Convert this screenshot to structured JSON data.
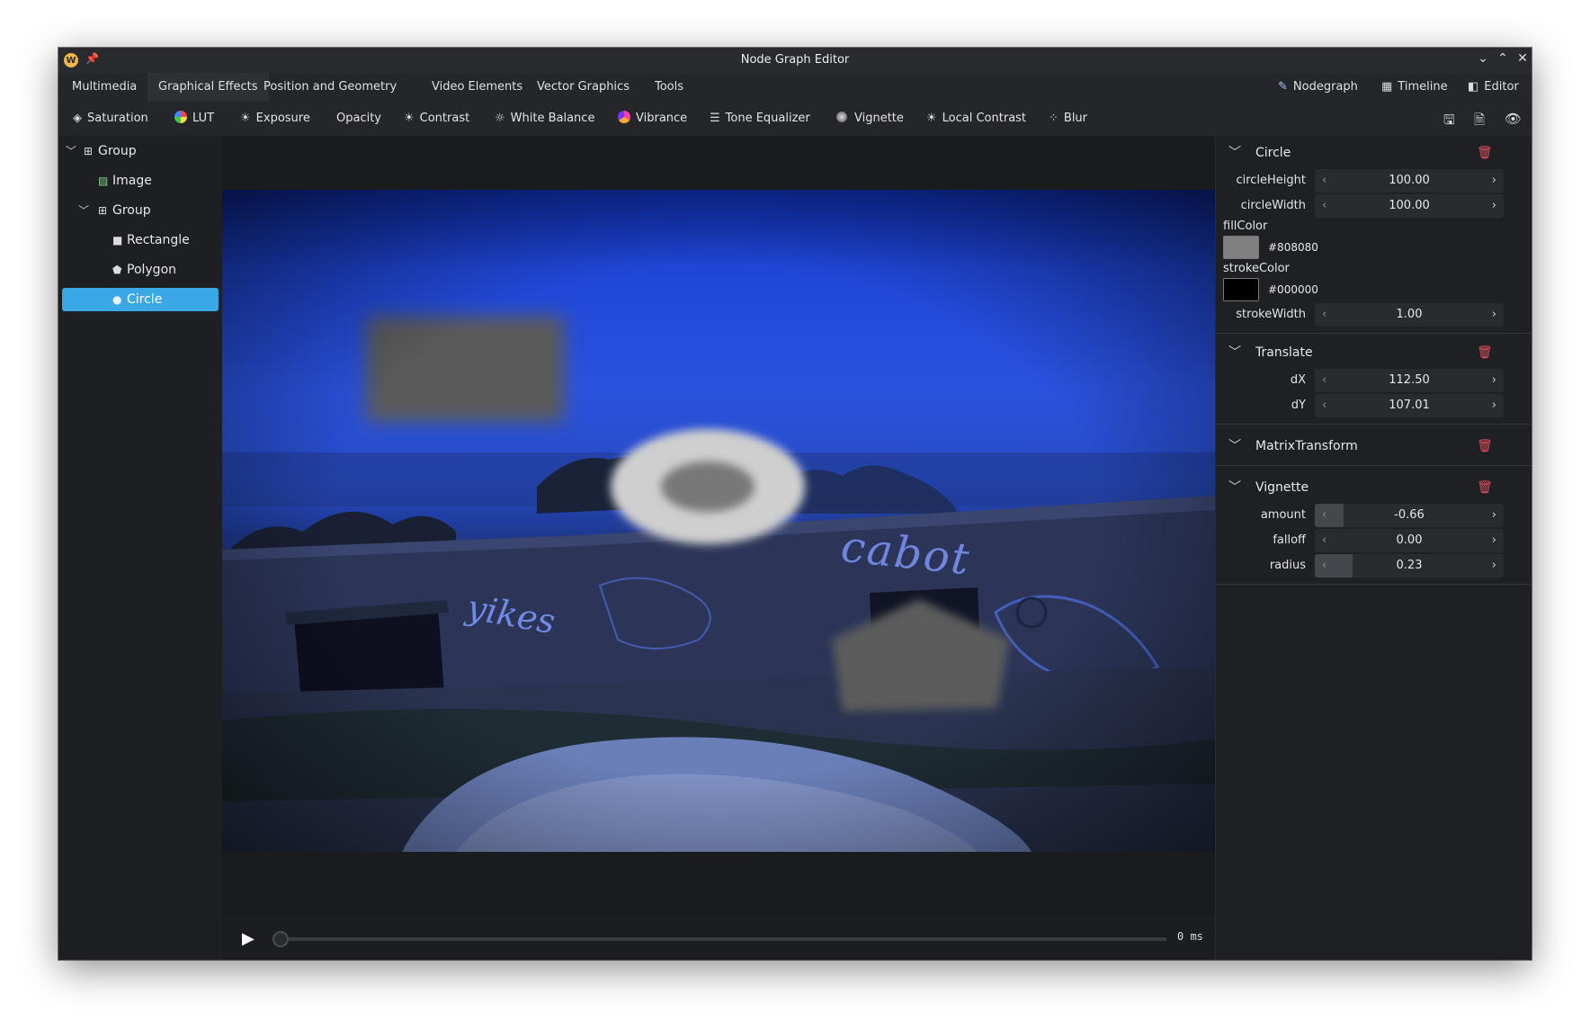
{
  "window": {
    "title": "Node Graph Editor",
    "app_icon_letter": "W"
  },
  "menu": {
    "tabs": [
      "Multimedia",
      "Graphical Effects",
      "Position and Geometry",
      "Video Elements",
      "Vector Graphics",
      "Tools"
    ],
    "active_tab": "Graphical Effects",
    "right": {
      "nodegraph": "Nodegraph",
      "timeline": "Timeline",
      "editor": "Editor"
    }
  },
  "toolbar": {
    "saturation": "Saturation",
    "lut": "LUT",
    "exposure": "Exposure",
    "opacity": "Opacity",
    "contrast": "Contrast",
    "white_balance": "White Balance",
    "vibrance": "Vibrance",
    "tone_equalizer": "Tone Equalizer",
    "vignette": "Vignette",
    "local_contrast": "Local Contrast",
    "blur": "Blur"
  },
  "tree": {
    "items": [
      {
        "label": "Group",
        "depth": 0,
        "expanded": true
      },
      {
        "label": "Image",
        "depth": 1
      },
      {
        "label": "Group",
        "depth": 1,
        "expanded": true
      },
      {
        "label": "Rectangle",
        "depth": 2
      },
      {
        "label": "Polygon",
        "depth": 2
      },
      {
        "label": "Circle",
        "depth": 2,
        "selected": true
      }
    ]
  },
  "viewer": {
    "graffiti": {
      "yikes": "yikes",
      "cabot": "cabot"
    }
  },
  "timeline": {
    "time": "0 ms",
    "position": 0
  },
  "properties": {
    "circle": {
      "title": "Circle",
      "circleHeight": {
        "label": "circleHeight",
        "value": "100.00"
      },
      "circleWidth": {
        "label": "circleWidth",
        "value": "100.00"
      },
      "fillColor": {
        "label": "fillColor",
        "hex": "#808080"
      },
      "strokeColor": {
        "label": "strokeColor",
        "hex": "#000000"
      },
      "strokeWidth": {
        "label": "strokeWidth",
        "value": "1.00"
      }
    },
    "translate": {
      "title": "Translate",
      "dX": {
        "label": "dX",
        "value": "112.50"
      },
      "dY": {
        "label": "dY",
        "value": "107.01"
      }
    },
    "matrix": {
      "title": "MatrixTransform"
    },
    "vignette": {
      "title": "Vignette",
      "amount": {
        "label": "amount",
        "value": "-0.66",
        "fill_fraction": 0.15
      },
      "falloff": {
        "label": "falloff",
        "value": "0.00",
        "fill_fraction": 0
      },
      "radius": {
        "label": "radius",
        "value": "0.23",
        "fill_fraction": 0.2
      }
    }
  },
  "colors": {
    "accent": "#3aa8e4",
    "delete": "#e0505a",
    "fill_swatch": "#808080",
    "stroke_swatch": "#000000"
  }
}
